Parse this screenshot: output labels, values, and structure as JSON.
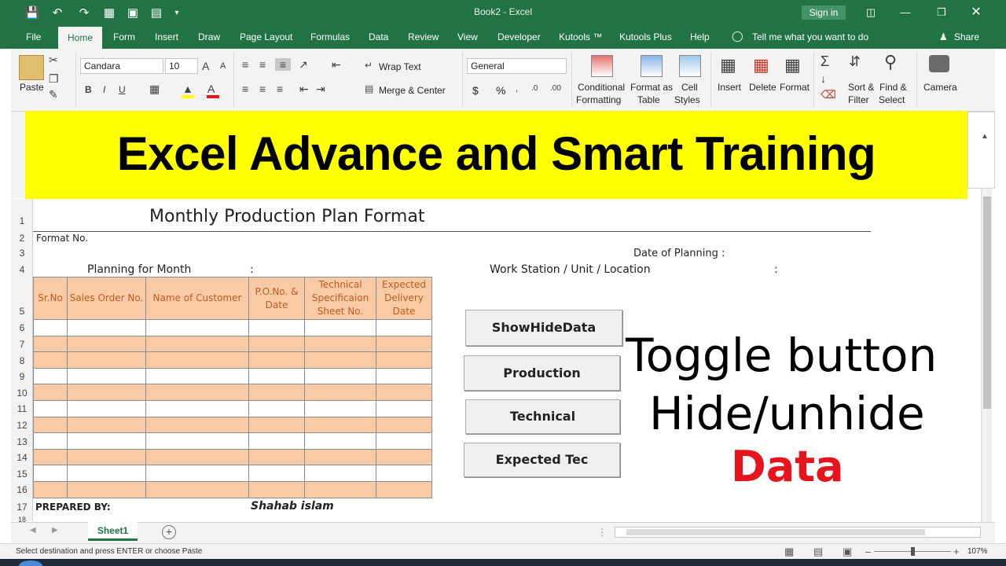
{
  "window": {
    "title": "Book2  -  Excel",
    "signin": "Sign in",
    "share": "Share",
    "tell_me": "Tell me what you want to do"
  },
  "menu": [
    "File",
    "Home",
    "Form",
    "Insert",
    "Draw",
    "Page Layout",
    "Formulas",
    "Data",
    "Review",
    "View",
    "Developer",
    "Kutools ™",
    "Kutools Plus",
    "Help"
  ],
  "ribbon": {
    "paste": "Paste",
    "font_name": "Candara",
    "font_size": "10",
    "wrap_text": "Wrap Text",
    "merge_center": "Merge & Center",
    "number_format": "General",
    "conditional_formatting": [
      "Conditional",
      "Formatting"
    ],
    "format_as_table": [
      "Format as",
      "Table"
    ],
    "cell_styles": [
      "Cell",
      "Styles"
    ],
    "insert": "Insert",
    "delete": "Delete",
    "format": "Format",
    "sort_filter": [
      "Sort &",
      "Filter"
    ],
    "find_select": [
      "Find &",
      "Select"
    ],
    "camera": "Camera",
    "bold": "B",
    "italic": "I",
    "underline": "U",
    "dollar": "$",
    "percent": "%"
  },
  "banner": "Excel Advance and Smart Training",
  "sheet": {
    "title": "Monthly Production Plan Format",
    "format_no": "Format No.",
    "date_of_planning": "Date of Planning :",
    "planning_for_month": "Planning for Month",
    "colon": ":",
    "work_station": "Work Station / Unit / Location",
    "headers": [
      "Sr.No",
      "Sales Order No.",
      "Name of Customer",
      "P.O.No. & Date",
      "Technical Specificaion Sheet No.",
      "Expected Delivery Date"
    ],
    "prepared_by": "PREPARED BY:",
    "preparer": "Shahab islam",
    "row_numbers": [
      "1",
      "2",
      "3",
      "4",
      "5",
      "6",
      "7",
      "8",
      "9",
      "10",
      "11",
      "12",
      "13",
      "14",
      "15",
      "16",
      "17",
      "18"
    ]
  },
  "buttons": {
    "show_hide": "ShowHideData",
    "production": "Production",
    "technical": "Technical",
    "expected": "Expected Tec"
  },
  "overlay": {
    "line1": "Toggle button",
    "line2": "Hide/unhide",
    "line3": "Data",
    "accent": "#e8141b"
  },
  "tabs": {
    "sheet1": "Sheet1",
    "add": "+"
  },
  "status": {
    "message": "Select destination and press ENTER or choose Paste",
    "zoom": "107%"
  }
}
